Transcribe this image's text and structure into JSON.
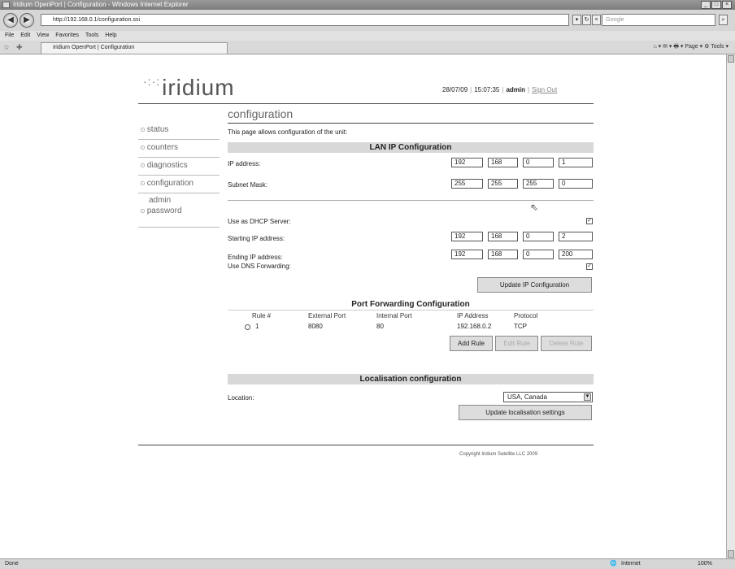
{
  "window": {
    "title": "Iridium OpenPort | Configuration - Windows Internet Explorer",
    "controls": [
      "_",
      "□",
      "×"
    ]
  },
  "browser": {
    "url": "http://192.168.0.1/configuration.ssi",
    "search_placeholder": "Google",
    "menu": [
      "File",
      "Edit",
      "View",
      "Favorites",
      "Tools",
      "Help"
    ],
    "tab_title": "Iridium OpenPort | Configuration",
    "commands": "⌂ ▾ ✉ ▾ 🖶 ▾ Page ▾ ⚙ Tools ▾",
    "status_left": "Done",
    "status_zone": "Internet",
    "zoom": "100%"
  },
  "header": {
    "logo_text": "iridium",
    "date": "28/07/09",
    "time": "15:07:35",
    "user": "admin",
    "sign_out": "Sign Out"
  },
  "sidebar": {
    "items": [
      {
        "label": "status"
      },
      {
        "label": "counters"
      },
      {
        "label": "diagnostics"
      },
      {
        "label": "configuration"
      },
      {
        "label_line1": "admin",
        "label_line2": "password"
      }
    ]
  },
  "page": {
    "title": "configuration",
    "intro": "This page allows configuration of the unit:"
  },
  "lan": {
    "heading": "LAN IP Configuration",
    "ip_label": "IP address:",
    "ip": [
      "192",
      "168",
      "0",
      "1"
    ],
    "mask_label": "Subnet Mask:",
    "mask": [
      "255",
      "255",
      "255",
      "0"
    ],
    "dhcp_label": "Use as DHCP Server:",
    "dhcp_checked": true,
    "start_label": "Starting IP address:",
    "start_ip": [
      "192",
      "168",
      "0",
      "2"
    ],
    "end_label": "Ending IP address:",
    "end_ip": [
      "192",
      "168",
      "0",
      "200"
    ],
    "dns_label": "Use DNS Forwarding:",
    "dns_checked": true,
    "update_button": "Update IP Configuration"
  },
  "port_forwarding": {
    "heading": "Port Forwarding Configuration",
    "columns": [
      "Rule #",
      "External Port",
      "Internal Port",
      "IP Address",
      "Protocol"
    ],
    "rows": [
      {
        "rule": "1",
        "external": "8080",
        "internal": "80",
        "ip": "192.168.0.2",
        "protocol": "TCP"
      }
    ],
    "add_button": "Add Rule",
    "edit_button": "Edit Rule",
    "delete_button": "Delete Rule"
  },
  "localisation": {
    "heading": "Localisation configuration",
    "location_label": "Location:",
    "location_value": "USA, Canada",
    "update_button": "Update localisation settings"
  },
  "footer": {
    "copyright": "Copyright Iridium Satellite LLC 2009"
  }
}
